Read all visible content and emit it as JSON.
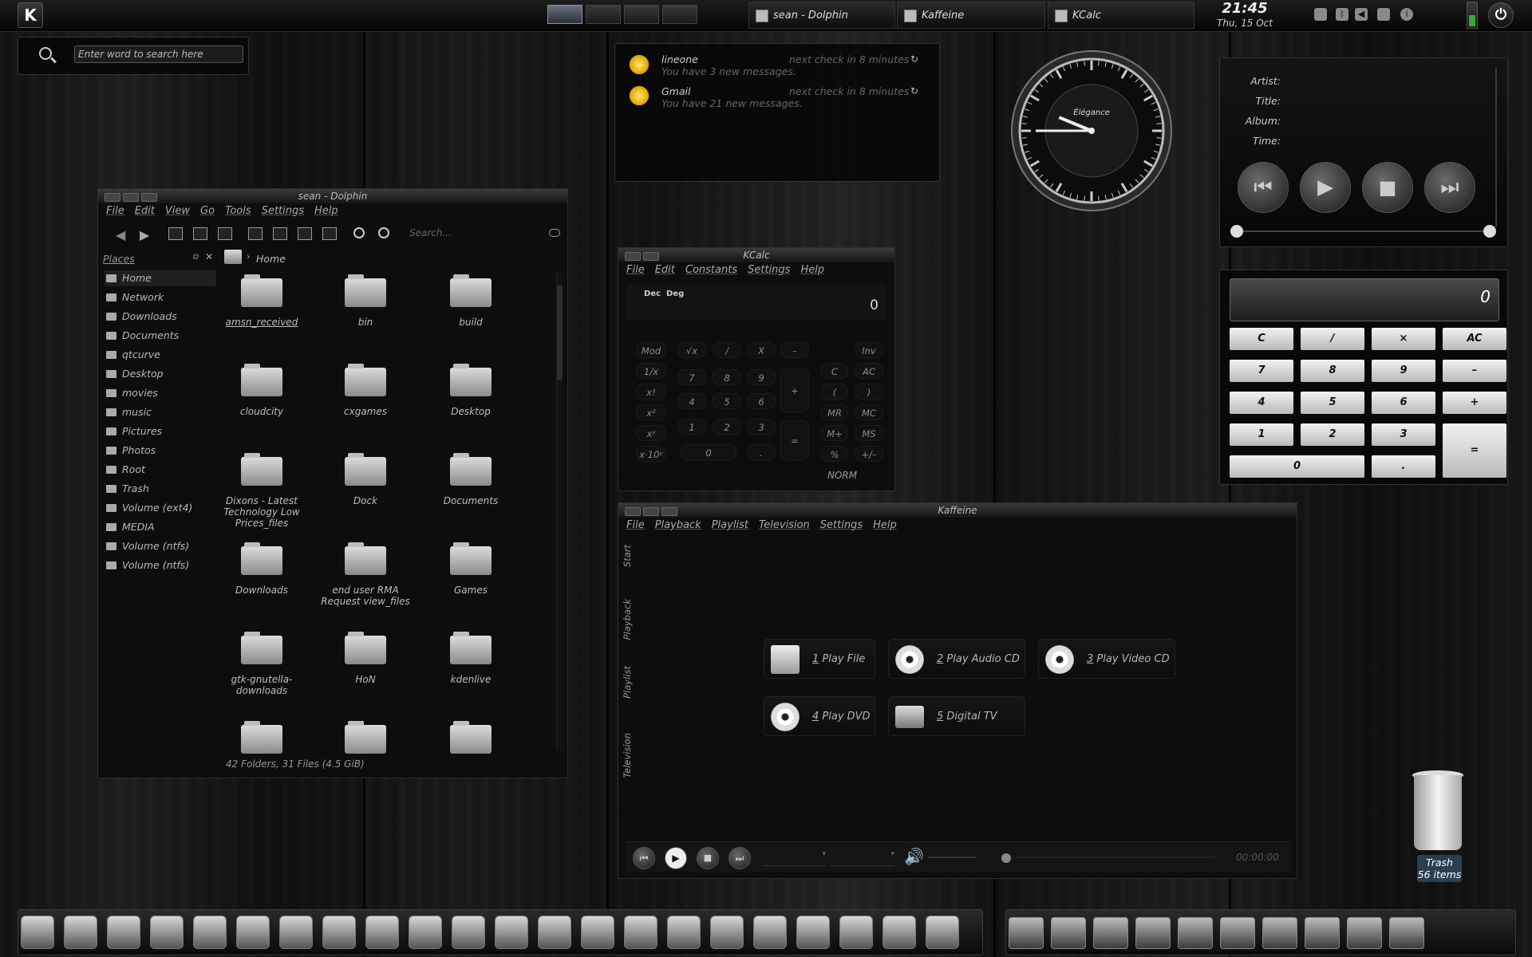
{
  "top_panel": {
    "tasks": [
      {
        "label": "sean - Dolphin"
      },
      {
        "label": "Kaffeine"
      },
      {
        "label": "KCalc"
      }
    ],
    "clock_time": "21:45",
    "clock_date": "Thu, 15 Oct"
  },
  "dictionary": {
    "placeholder": "Enter word to search here"
  },
  "mail": {
    "accounts": [
      {
        "name": "lineone",
        "next_check": "next check in 8 minutes",
        "message": "You have 3 new messages."
      },
      {
        "name": "Gmail",
        "next_check": "next check in 8 minutes",
        "message": "You have 21 new messages."
      }
    ]
  },
  "analog_clock": {
    "brand": "Élégance",
    "hour": 9,
    "minute": 45
  },
  "now_playing": {
    "labels": {
      "artist": "Artist:",
      "title": "Title:",
      "album": "Album:",
      "time": "Time:"
    },
    "values": {
      "artist": "",
      "title": "",
      "album": "",
      "time": ""
    }
  },
  "calculator_widget": {
    "display": "0",
    "buttons": [
      "C",
      "/",
      "×",
      "AC",
      "7",
      "8",
      "9",
      "–",
      "4",
      "5",
      "6",
      "+",
      "1",
      "2",
      "3",
      "=",
      "0",
      "."
    ]
  },
  "dolphin": {
    "title": "sean - Dolphin",
    "menu": [
      "File",
      "Edit",
      "View",
      "Go",
      "Tools",
      "Settings",
      "Help"
    ],
    "search_placeholder": "Search...",
    "places_header": "Places",
    "places": [
      "Home",
      "Network",
      "Downloads",
      "Documents",
      "qtcurve",
      "Desktop",
      "movies",
      "music",
      "Pictures",
      "Photos",
      "Root",
      "Trash",
      "Volume (ext4)",
      "MEDIA",
      "Volume (ntfs)",
      "Volume (ntfs)"
    ],
    "breadcrumb": "Home",
    "items": [
      "amsn_received",
      "bin",
      "build",
      "cloudcity",
      "cxgames",
      "Desktop",
      "Dixons - Latest Technology Low Prices_files",
      "Dock",
      "Documents",
      "Downloads",
      "end user RMA Request view_files",
      "Games",
      "gtk-gnutella-downloads",
      "HoN",
      "kdenlive"
    ],
    "status": "42 Folders, 31 Files (4.5 GiB)"
  },
  "kcalc": {
    "title": "KCalc",
    "menu": [
      "File",
      "Edit",
      "Constants",
      "Settings",
      "Help"
    ],
    "base": "Dec",
    "angle": "Deg",
    "display": "0",
    "left_col": [
      "Mod",
      "1/x",
      "x!",
      "x²",
      "xʸ",
      "x·10ʸ"
    ],
    "keys": [
      "√x",
      "/",
      "X",
      "–",
      "7",
      "8",
      "9",
      "4",
      "5",
      "6",
      "1",
      "2",
      "3",
      "0",
      "."
    ],
    "plus": "+",
    "equals": "=",
    "right_a": [
      "C",
      "(",
      "MR",
      "M+",
      "%"
    ],
    "right_b": [
      "Inv",
      "AC",
      ")",
      "MC",
      "MS",
      "+/–"
    ],
    "mode": "NORM"
  },
  "kaffeine": {
    "title": "Kaffeine",
    "menu": [
      "File",
      "Playback",
      "Playlist",
      "Television",
      "Settings",
      "Help"
    ],
    "side_tabs": [
      "Start",
      "Playback",
      "Playlist",
      "Television"
    ],
    "buttons": [
      {
        "num": "1",
        "label": " Play File"
      },
      {
        "num": "2",
        "label": " Play Audio CD"
      },
      {
        "num": "3",
        "label": " Play Video CD"
      },
      {
        "num": "4",
        "label": " Play DVD"
      },
      {
        "num": "5",
        "label": " Digital TV"
      }
    ],
    "time": "00:00:00"
  },
  "trash": {
    "label": "Trash",
    "count": "56 items"
  }
}
